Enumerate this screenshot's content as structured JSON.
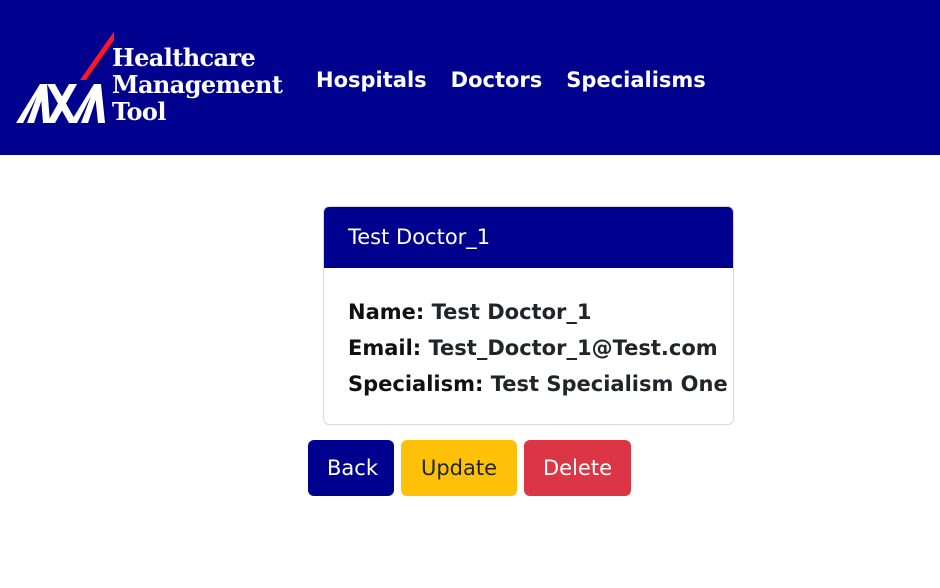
{
  "navbar": {
    "brand": {
      "logo_text": "AXA",
      "title_lines": [
        "Healthcare",
        "Management",
        "Tool"
      ]
    },
    "links": [
      "Hospitals",
      "Doctors",
      "Specialisms"
    ],
    "background_color": "#00008f"
  },
  "card": {
    "header": "Test Doctor_1",
    "fields": [
      {
        "label": "Name:",
        "value": "Test Doctor_1"
      },
      {
        "label": "Email:",
        "value": "Test_Doctor_1@Test.com"
      },
      {
        "label": "Specialism:",
        "value": "Test Specialism One"
      }
    ]
  },
  "actions": {
    "back": "Back",
    "update": "Update",
    "delete": "Delete"
  },
  "colors": {
    "brand_blue": "#00008f",
    "logo_slash_red": "#ff1721",
    "update_yellow": "#ffc107",
    "delete_red": "#dc3545"
  }
}
